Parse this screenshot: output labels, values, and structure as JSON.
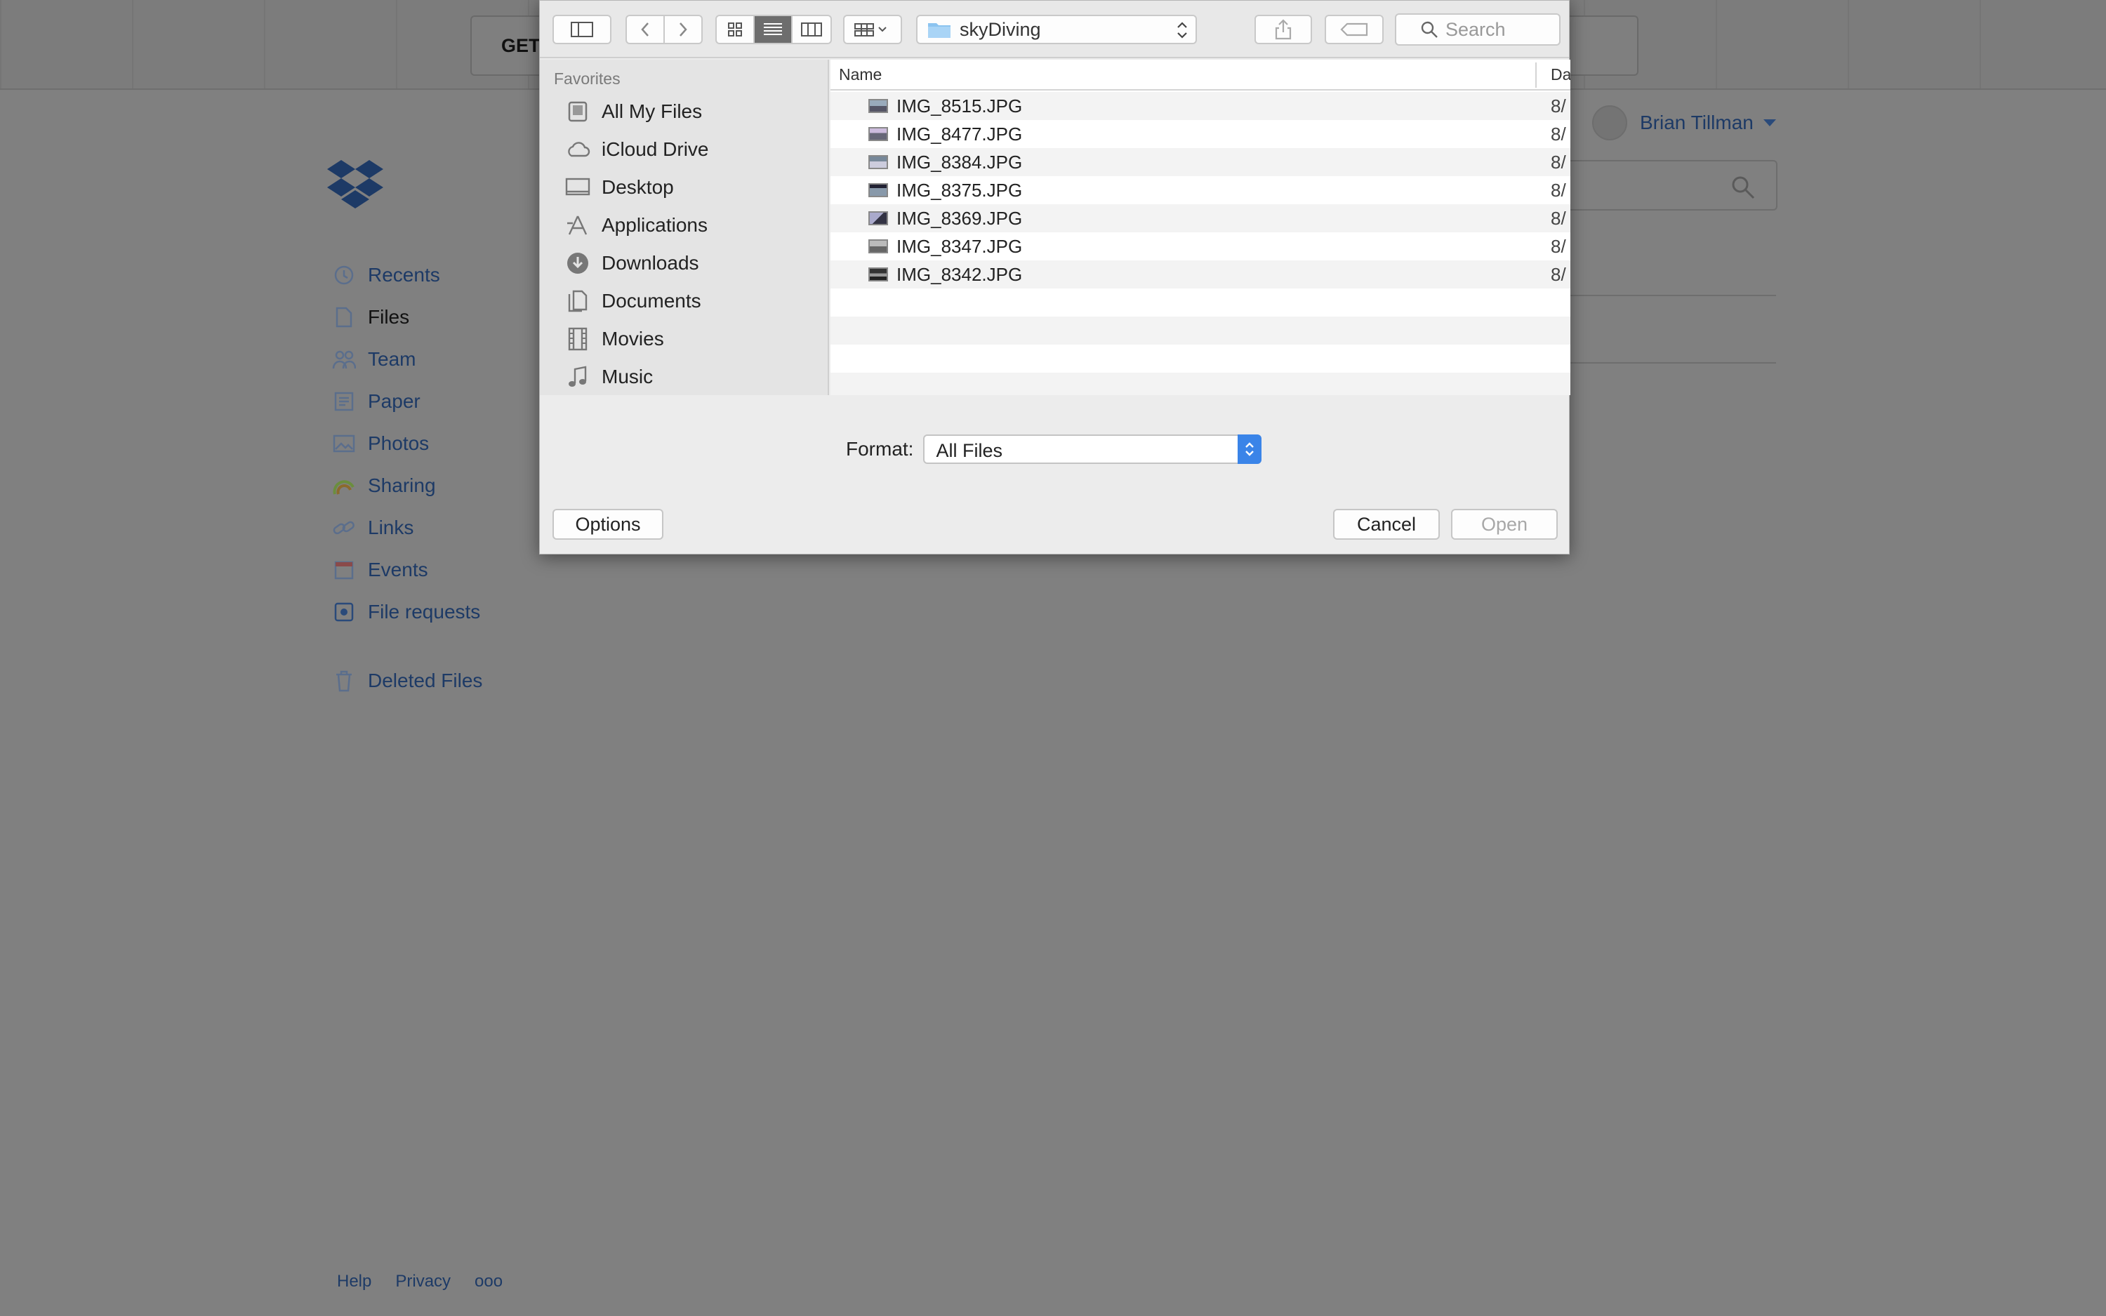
{
  "background": {
    "banner_label": "GET",
    "nav": [
      {
        "label": "Recents",
        "icon": "clock-icon"
      },
      {
        "label": "Files",
        "icon": "file-icon",
        "active": true
      },
      {
        "label": "Team",
        "icon": "team-icon"
      },
      {
        "label": "Paper",
        "icon": "paper-icon"
      },
      {
        "label": "Photos",
        "icon": "photos-icon"
      },
      {
        "label": "Sharing",
        "icon": "sharing-icon"
      },
      {
        "label": "Links",
        "icon": "link-icon"
      },
      {
        "label": "Events",
        "icon": "calendar-icon"
      },
      {
        "label": "File requests",
        "icon": "file-request-icon"
      },
      {
        "label": "Deleted Files",
        "icon": "trash-icon"
      }
    ],
    "user_name": "Brian Tillman",
    "footer": {
      "help": "Help",
      "privacy": "Privacy",
      "more": "ooo"
    }
  },
  "dialog": {
    "location": "skyDiving",
    "search_placeholder": "Search",
    "sidebar": {
      "heading": "Favorites",
      "items": [
        {
          "label": "All My Files",
          "icon": "all-files-icon"
        },
        {
          "label": "iCloud Drive",
          "icon": "cloud-icon"
        },
        {
          "label": "Desktop",
          "icon": "desktop-icon"
        },
        {
          "label": "Applications",
          "icon": "applications-icon"
        },
        {
          "label": "Downloads",
          "icon": "downloads-icon"
        },
        {
          "label": "Documents",
          "icon": "documents-icon"
        },
        {
          "label": "Movies",
          "icon": "movies-icon"
        },
        {
          "label": "Music",
          "icon": "music-icon"
        }
      ]
    },
    "columns": {
      "name": "Name",
      "date": "Da"
    },
    "files": [
      {
        "name": "IMG_8515.JPG",
        "date": "8/"
      },
      {
        "name": "IMG_8477.JPG",
        "date": "8/"
      },
      {
        "name": "IMG_8384.JPG",
        "date": "8/"
      },
      {
        "name": "IMG_8375.JPG",
        "date": "8/"
      },
      {
        "name": "IMG_8369.JPG",
        "date": "8/"
      },
      {
        "name": "IMG_8347.JPG",
        "date": "8/"
      },
      {
        "name": "IMG_8342.JPG",
        "date": "8/"
      }
    ],
    "format_label": "Format:",
    "format_value": "All Files",
    "options_label": "Options",
    "cancel_label": "Cancel",
    "open_label": "Open"
  }
}
